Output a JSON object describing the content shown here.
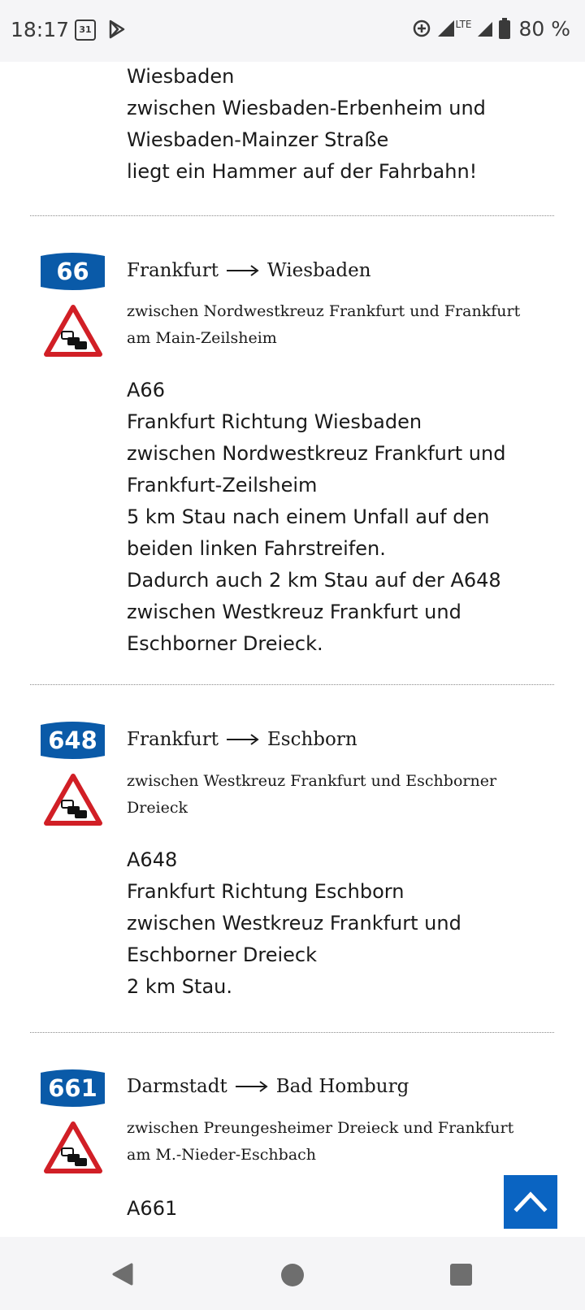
{
  "status_bar": {
    "time": "18:17",
    "calendar_day": "31",
    "network": "LTE",
    "battery": "80 %"
  },
  "entries": [
    {
      "details": [
        "Wiesbaden",
        "zwischen Wiesbaden-Erbenheim und",
        "Wiesbaden-Mainzer Straße",
        "liegt ein Hammer auf der Fahrbahn!"
      ]
    },
    {
      "road": "66",
      "from": "Frankfurt",
      "to": "Wiesbaden",
      "between": [
        "zwischen Nordwestkreuz Frankfurt und Frankfurt",
        "am Main-Zeilsheim"
      ],
      "details": [
        "A66",
        "Frankfurt Richtung Wiesbaden",
        "zwischen Nordwestkreuz Frankfurt und",
        "Frankfurt-Zeilsheim",
        "5 km Stau nach einem Unfall auf den",
        "beiden linken Fahrstreifen.",
        "Dadurch auch 2 km Stau auf der A648",
        "zwischen Westkreuz Frankfurt und",
        "Eschborner Dreieck."
      ]
    },
    {
      "road": "648",
      "from": "Frankfurt",
      "to": "Eschborn",
      "between": [
        "zwischen Westkreuz Frankfurt und Eschborner",
        "Dreieck"
      ],
      "details": [
        "A648",
        "Frankfurt Richtung Eschborn",
        "zwischen Westkreuz Frankfurt und",
        "Eschborner Dreieck",
        "2 km Stau."
      ]
    },
    {
      "road": "661",
      "from": "Darmstadt",
      "to": "Bad Homburg",
      "between": [
        "zwischen Preungesheimer Dreieck und Frankfurt",
        "am M.-Nieder-Eschbach"
      ],
      "details": [
        "A661"
      ]
    }
  ],
  "colors": {
    "road_badge": "#0a5aa8",
    "warning_red": "#d11f26",
    "scroll_top_button": "#0a64c2"
  },
  "icons": {
    "scroll_top": "chevron-up-icon",
    "traffic_jam": "traffic-jam-warning-icon",
    "nav_back": "back-icon",
    "nav_home": "home-icon",
    "nav_recents": "recents-icon"
  }
}
